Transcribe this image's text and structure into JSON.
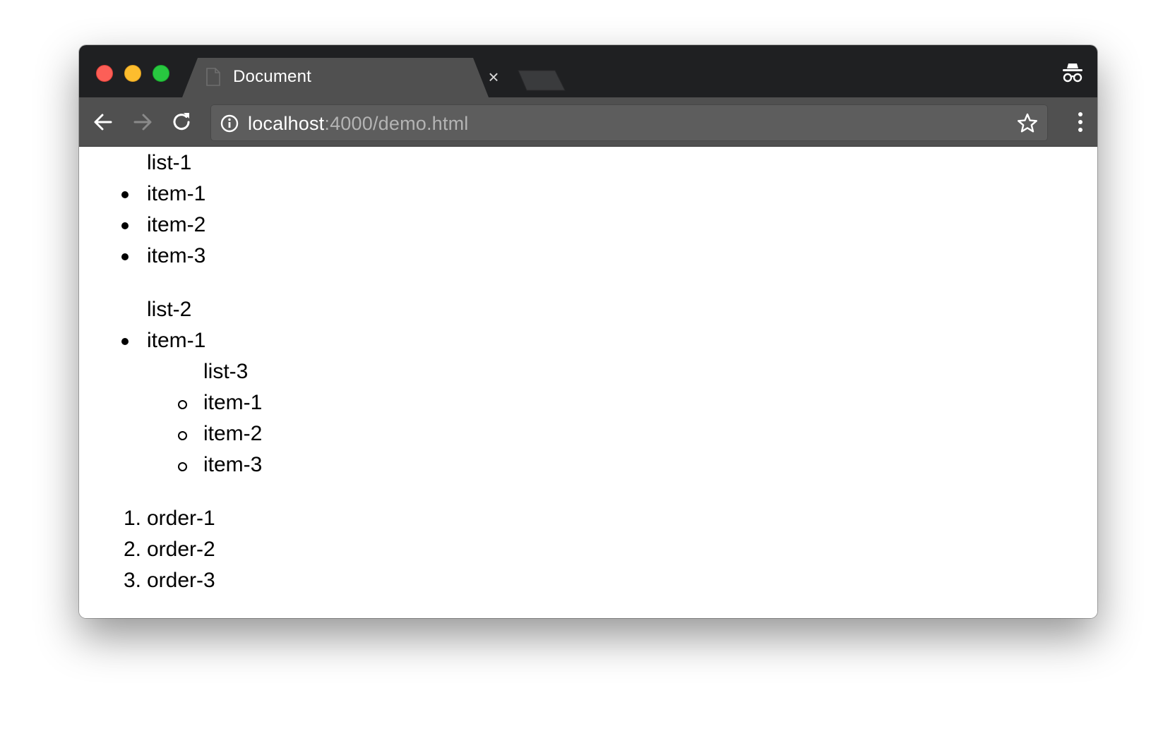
{
  "browser": {
    "tab_title": "Document",
    "close_glyph": "×",
    "url_host": "localhost",
    "url_path": ":4000/demo.html",
    "icons": {
      "favicon": "document-icon",
      "close": "close-icon",
      "new_tab": "new-tab-icon",
      "incognito": "incognito-icon",
      "back": "back-arrow-icon",
      "forward": "forward-arrow-icon",
      "reload": "reload-icon",
      "site_info": "info-icon",
      "bookmark": "star-icon",
      "menu": "kebab-menu-icon"
    },
    "colors": {
      "tab_strip": "#1f2022",
      "active_tab": "#505050",
      "toolbar": "#505050",
      "omnibox": "#5d5d5d",
      "close_dot": "#fc5f57",
      "minimize_dot": "#fdbd2e",
      "zoom_dot": "#28c840"
    }
  },
  "page": {
    "list1": {
      "caption": "list-1",
      "items": [
        "item-1",
        "item-2",
        "item-3"
      ]
    },
    "list2": {
      "caption": "list-2",
      "items": [
        "item-1"
      ],
      "nested": {
        "caption": "list-3",
        "items": [
          "item-1",
          "item-2",
          "item-3"
        ]
      }
    },
    "ordered": {
      "numbers": [
        "1.",
        "2.",
        "3."
      ],
      "items": [
        "order-1",
        "order-2",
        "order-3"
      ]
    }
  }
}
